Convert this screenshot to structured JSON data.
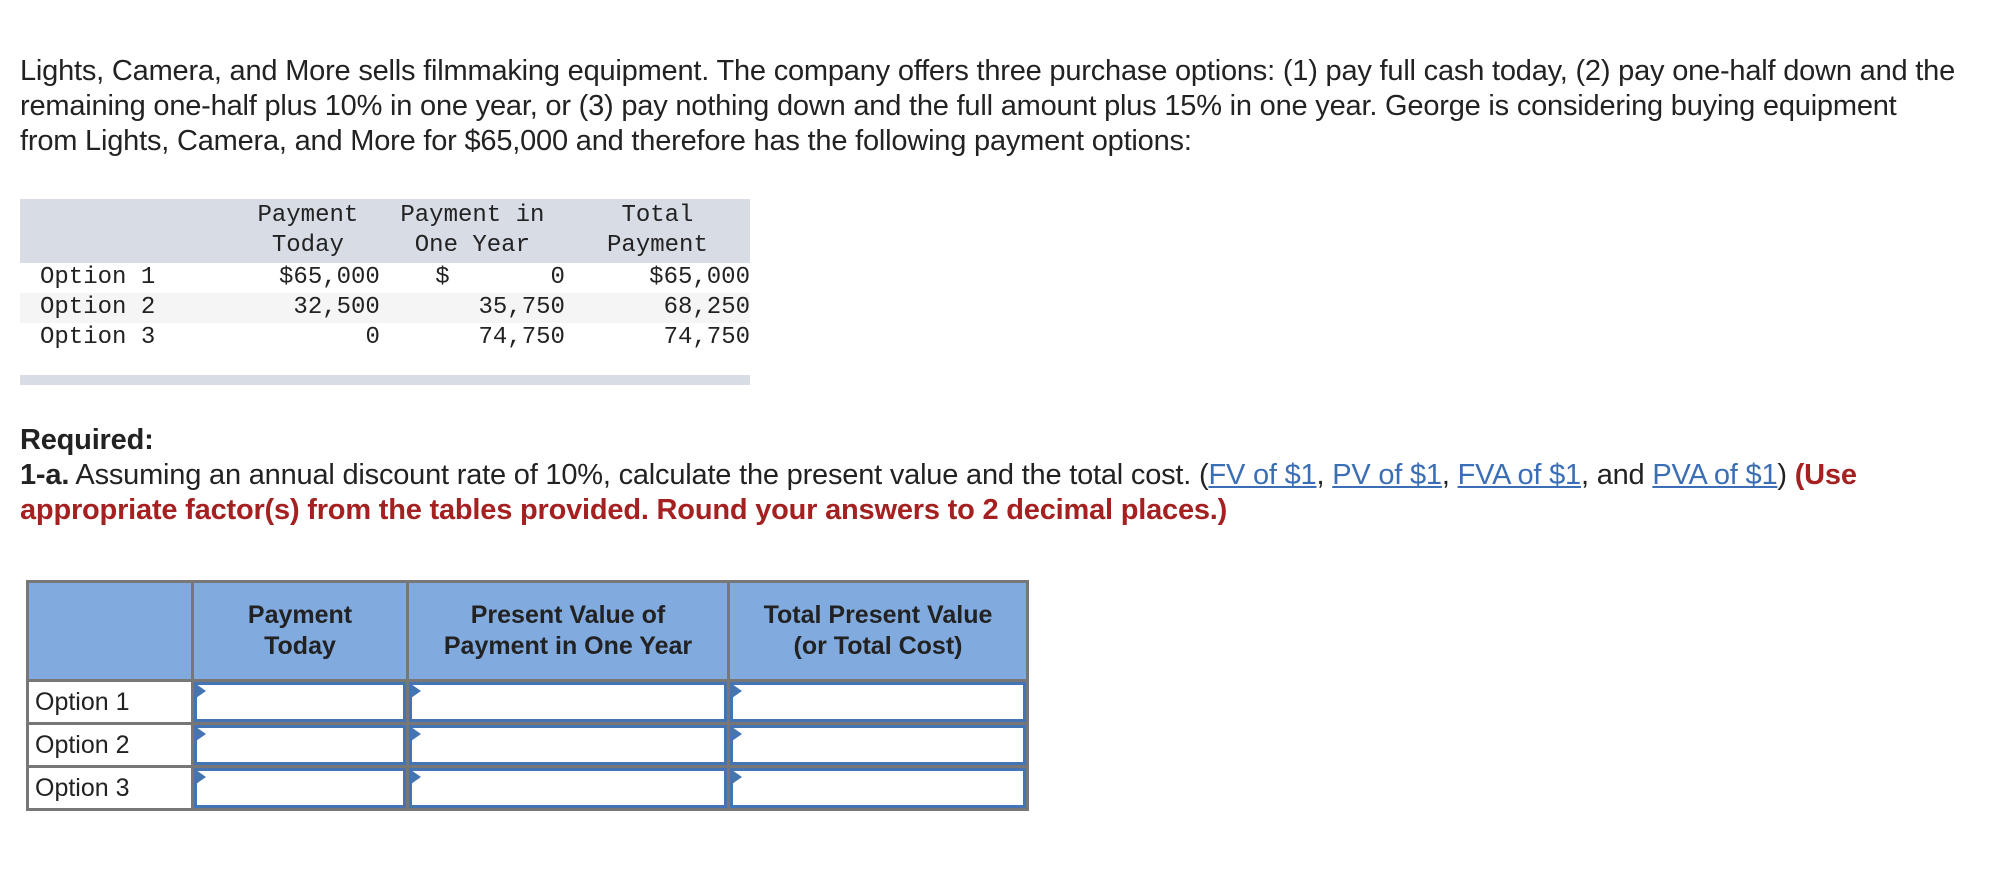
{
  "intro_text": "Lights, Camera, and More sells filmmaking equipment. The company offers three purchase options: (1) pay full cash today, (2) pay one-half down and the remaining one-half plus 10% in one year, or (3) pay nothing down and the full amount plus 15% in one year. George is considering buying equipment from Lights, Camera, and More for $65,000 and therefore has the following payment options:",
  "given_table": {
    "headers": [
      "",
      "Payment\nToday",
      "Payment in\nOne Year",
      "Total\nPayment"
    ],
    "rows": [
      {
        "label": "Option 1",
        "today": "$65,000",
        "one_year": "$       0",
        "total": "$65,000"
      },
      {
        "label": "Option 2",
        "today": "32,500",
        "one_year": "35,750",
        "total": "68,250"
      },
      {
        "label": "Option 3",
        "today": "0",
        "one_year": "74,750",
        "total": "74,750"
      }
    ]
  },
  "required": {
    "title": "Required:",
    "part_number": "1-a.",
    "question": " Assuming an annual discount rate of 10%, calculate the present value and the total cost. (",
    "links": [
      {
        "label": "FV of $1"
      },
      {
        "label": "PV of $1"
      },
      {
        "label": "FVA of $1"
      },
      {
        "label": "PVA of $1"
      }
    ],
    "sep1": ", ",
    "sep2": ", ",
    "sep3": ", and ",
    "close_paren": ") ",
    "instructions": "(Use appropriate factor(s) from the tables provided. Round your answers to 2 decimal places.)"
  },
  "answer_table": {
    "headers": [
      "",
      "Payment Today",
      "Present Value of Payment in One Year",
      "Total Present Value (or Total Cost)"
    ],
    "header_lines": {
      "col1_l1": "Payment",
      "col1_l2": "Today",
      "col2_l1": "Present Value of",
      "col2_l2": "Payment in One Year",
      "col3_l1": "Total Present Value",
      "col3_l2": "(or Total Cost)"
    },
    "rows": [
      {
        "label": "Option 1",
        "payment_today": "",
        "pv_one_year": "",
        "total_pv": ""
      },
      {
        "label": "Option 2",
        "payment_today": "",
        "pv_one_year": "",
        "total_pv": ""
      },
      {
        "label": "Option 3",
        "payment_today": "",
        "pv_one_year": "",
        "total_pv": ""
      }
    ]
  },
  "colors": {
    "link": "#3b6eb5",
    "instruction_red": "#a52121",
    "answer_header_bg": "#81abdf",
    "input_border": "#4474b4",
    "given_header_bg": "#d8dce5"
  }
}
